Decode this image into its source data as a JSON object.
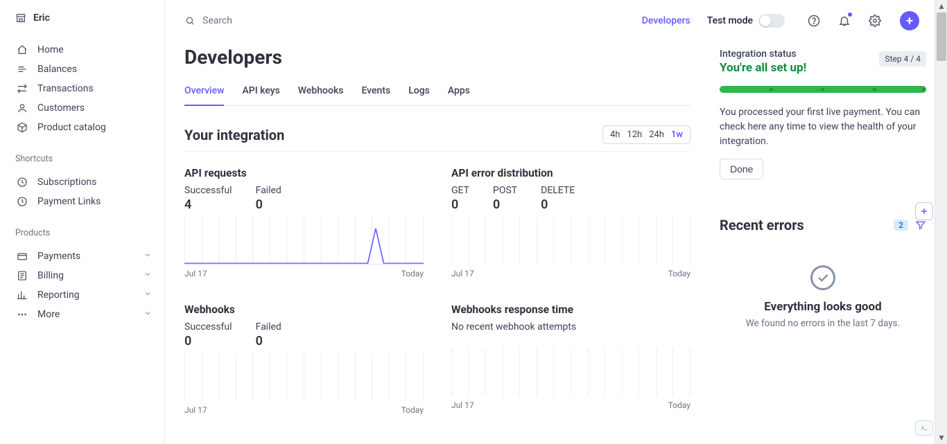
{
  "brand": {
    "name": "Eric"
  },
  "nav": {
    "main": [
      {
        "label": "Home",
        "icon": "home-icon"
      },
      {
        "label": "Balances",
        "icon": "balances-icon"
      },
      {
        "label": "Transactions",
        "icon": "transactions-icon"
      },
      {
        "label": "Customers",
        "icon": "customers-icon"
      },
      {
        "label": "Product catalog",
        "icon": "catalog-icon"
      }
    ],
    "shortcuts_label": "Shortcuts",
    "shortcuts": [
      {
        "label": "Subscriptions",
        "icon": "clock-icon"
      },
      {
        "label": "Payment Links",
        "icon": "clock-icon"
      }
    ],
    "products_label": "Products",
    "products": [
      {
        "label": "Payments",
        "icon": "payments-icon"
      },
      {
        "label": "Billing",
        "icon": "billing-icon"
      },
      {
        "label": "Reporting",
        "icon": "reporting-icon"
      },
      {
        "label": "More",
        "icon": "more-icon"
      }
    ]
  },
  "topbar": {
    "search_placeholder": "Search",
    "developers_link": "Developers",
    "test_mode_label": "Test mode"
  },
  "page": {
    "title": "Developers",
    "tabs": [
      "Overview",
      "API keys",
      "Webhooks",
      "Events",
      "Logs",
      "Apps"
    ],
    "active_tab": 0
  },
  "integration": {
    "title": "Your integration",
    "ranges": [
      "4h",
      "12h",
      "24h",
      "1w"
    ],
    "active_range": 3,
    "cards": {
      "api_requests": {
        "title": "API requests",
        "metrics": [
          {
            "label": "Successful",
            "value": "4"
          },
          {
            "label": "Failed",
            "value": "0"
          }
        ],
        "axis_start": "Jul 17",
        "axis_end": "Today"
      },
      "api_errors": {
        "title": "API error distribution",
        "metrics": [
          {
            "label": "GET",
            "value": "0"
          },
          {
            "label": "POST",
            "value": "0"
          },
          {
            "label": "DELETE",
            "value": "0"
          }
        ],
        "axis_start": "Jul 17",
        "axis_end": "Today"
      },
      "webhooks": {
        "title": "Webhooks",
        "metrics": [
          {
            "label": "Successful",
            "value": "0"
          },
          {
            "label": "Failed",
            "value": "0"
          }
        ],
        "axis_start": "Jul 17",
        "axis_end": "Today"
      },
      "webhooks_rt": {
        "title": "Webhooks response time",
        "message": "No recent webhook attempts",
        "axis_start": "Jul 17",
        "axis_end": "Today"
      }
    }
  },
  "status": {
    "label": "Integration status",
    "headline": "You're all set up!",
    "step": "Step 4 / 4",
    "text": "You processed your first live payment. You can check here any time to view the health of your integration.",
    "done_label": "Done"
  },
  "errors": {
    "title": "Recent errors",
    "badge": "2",
    "headline": "Everything looks good",
    "sub": "We found no errors in the last 7 days."
  },
  "chart_data": [
    {
      "type": "line",
      "title": "API requests",
      "x_range": [
        "Jul 17",
        "Today"
      ],
      "series": [
        {
          "name": "Successful",
          "total": 4,
          "values": [
            0,
            0,
            0,
            0,
            0,
            0,
            0,
            0,
            0,
            0,
            0,
            4,
            0,
            0
          ]
        },
        {
          "name": "Failed",
          "total": 0,
          "values": [
            0,
            0,
            0,
            0,
            0,
            0,
            0,
            0,
            0,
            0,
            0,
            0,
            0,
            0
          ]
        }
      ]
    },
    {
      "type": "bar",
      "title": "API error distribution",
      "categories": [
        "GET",
        "POST",
        "DELETE"
      ],
      "values": [
        0,
        0,
        0
      ],
      "x_range": [
        "Jul 17",
        "Today"
      ]
    },
    {
      "type": "line",
      "title": "Webhooks",
      "x_range": [
        "Jul 17",
        "Today"
      ],
      "series": [
        {
          "name": "Successful",
          "total": 0,
          "values": [
            0,
            0,
            0,
            0,
            0,
            0,
            0,
            0,
            0,
            0,
            0,
            0,
            0,
            0
          ]
        },
        {
          "name": "Failed",
          "total": 0,
          "values": [
            0,
            0,
            0,
            0,
            0,
            0,
            0,
            0,
            0,
            0,
            0,
            0,
            0,
            0
          ]
        }
      ]
    },
    {
      "type": "line",
      "title": "Webhooks response time",
      "x_range": [
        "Jul 17",
        "Today"
      ],
      "note": "No recent webhook attempts"
    }
  ]
}
